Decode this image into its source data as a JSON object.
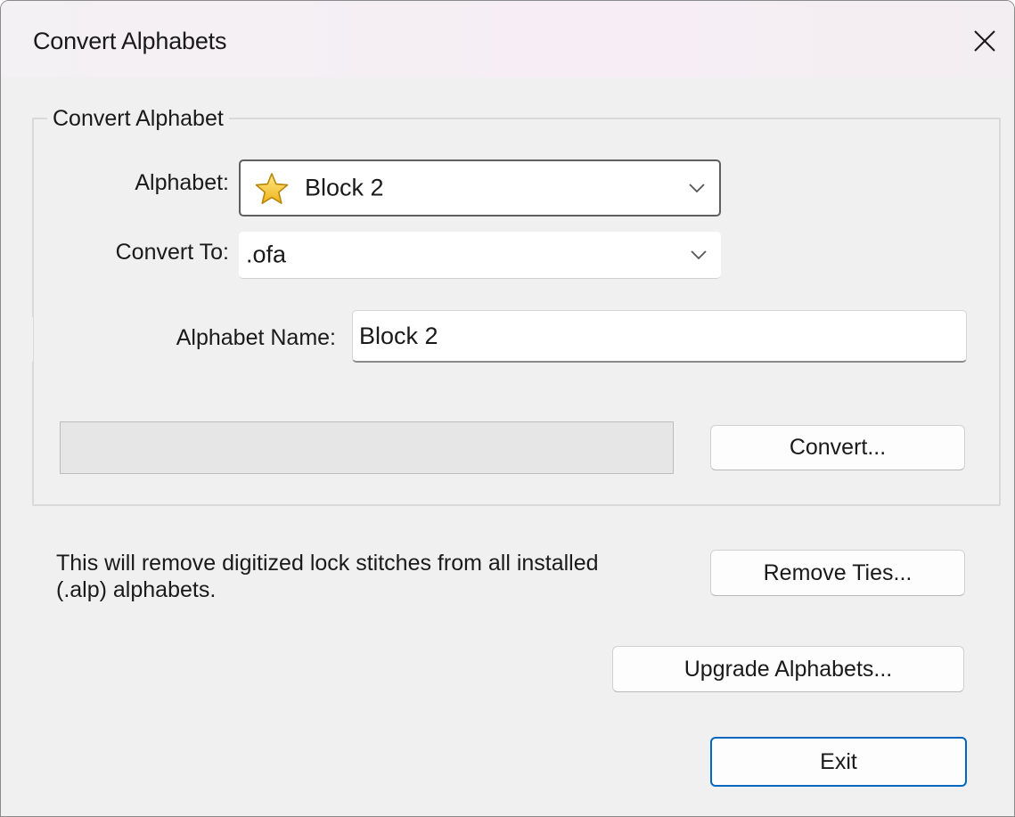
{
  "window": {
    "title": "Convert Alphabets",
    "close_icon": "close-icon"
  },
  "group": {
    "title": "Convert Alphabet"
  },
  "alphabet": {
    "label": "Alphabet:",
    "selected": "Block 2",
    "icon": "star-icon"
  },
  "convert_to": {
    "label": "Convert To:",
    "selected": ".ofa"
  },
  "alphabet_name": {
    "label": "Alphabet Name:",
    "value": "Block 2"
  },
  "progress": {
    "value": 0
  },
  "buttons": {
    "convert": "Convert...",
    "remove_ties": "Remove Ties...",
    "upgrade": "Upgrade Alphabets...",
    "exit": "Exit"
  },
  "info": {
    "text_line1": "This  will remove digitized lock stitches from all installed",
    "text_line2": "(.alp) alphabets."
  },
  "colors": {
    "accent": "#0067c0",
    "star_fill": "#f5c518",
    "star_stroke": "#b8860b"
  }
}
